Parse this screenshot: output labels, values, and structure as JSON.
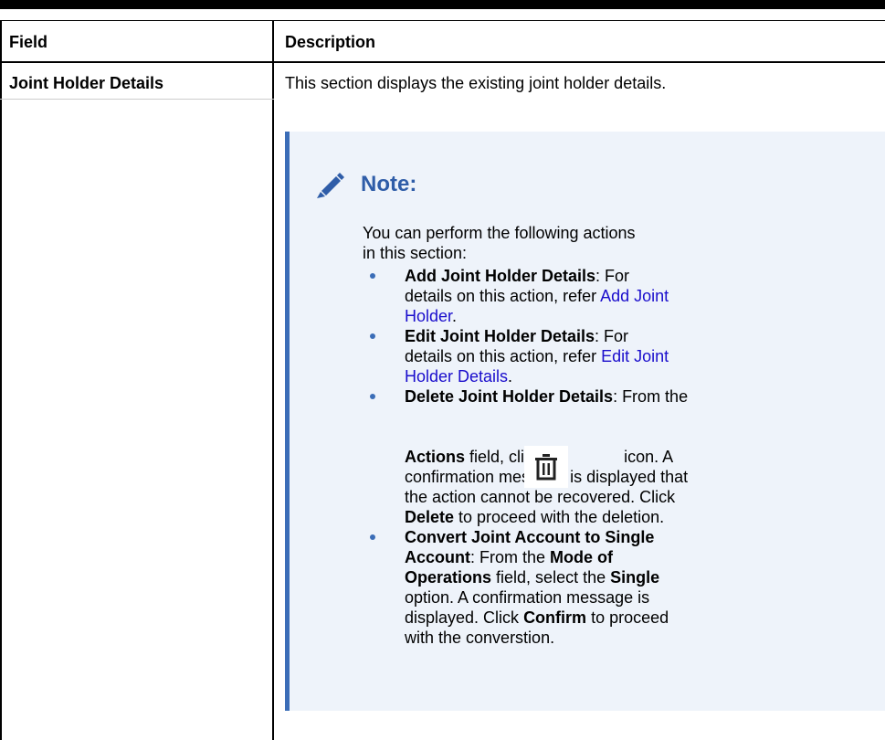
{
  "table": {
    "header": {
      "field": "Field",
      "description": "Description"
    },
    "row": {
      "field": "Joint Holder Details",
      "description": "This section displays the existing joint holder details."
    }
  },
  "note": {
    "icon": "pencil-icon",
    "title": "Note:",
    "intro": "You can perform the following actions in this section:",
    "items": [
      {
        "bold": "Add Joint Holder Details",
        "text": ": For details on this action, refer ",
        "link": "Add Joint Holder",
        "end": "."
      },
      {
        "bold": "Edit Joint Holder Details",
        "text": ": For details on this action, refer ",
        "link": "Edit Joint Holder Details",
        "end": "."
      },
      {
        "bold": "Delete Joint Holder Details",
        "text1": ": From the",
        "bold2": "Actions",
        "text2": " field, click the",
        "icon": "trash-icon",
        "text3": " icon. A confirmation message is displayed that the action cannot be recovered. Click ",
        "bold3": "Delete",
        "text4": " to proceed with the deletion."
      },
      {
        "bold": "Convert Joint Account to Single Account",
        "text1": ": From the ",
        "bold2": "Mode of Operations",
        "text2": " field, select the ",
        "bold3": "Single",
        "text3": " option. A confirmation message is displayed. Click ",
        "bold4": "Confirm",
        "text4": " to proceed with the converstion."
      }
    ]
  },
  "colors": {
    "accent": "#3b6db7",
    "note_bg": "#eef3fa",
    "link": "#1a0dcc",
    "title": "#2f5da8"
  }
}
